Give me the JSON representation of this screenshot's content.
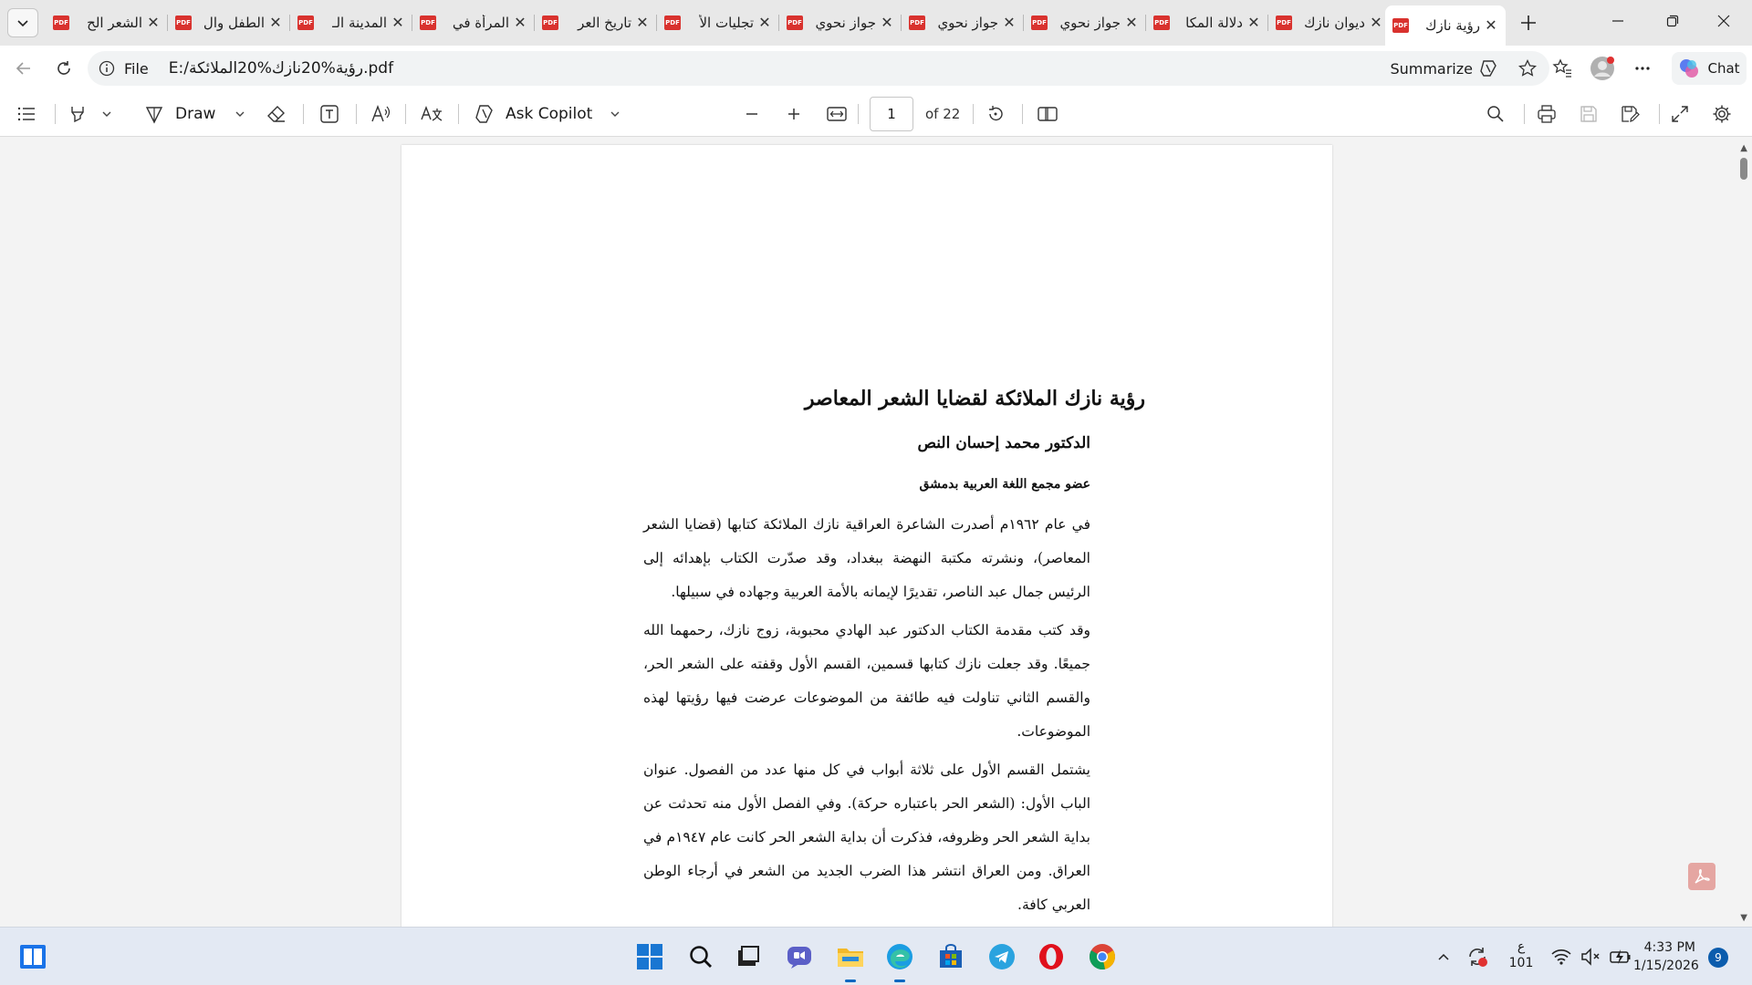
{
  "tabs": [
    {
      "title": "الشعر الح"
    },
    {
      "title": "الطفل وال"
    },
    {
      "title": "المدينة الـ"
    },
    {
      "title": "المرأة في"
    },
    {
      "title": "تاريخ العر"
    },
    {
      "title": "تجليات الأ"
    },
    {
      "title": "جواز نحوي"
    },
    {
      "title": "جواز نحوي"
    },
    {
      "title": "جواز نحوي"
    },
    {
      "title": "دلالة المكا"
    },
    {
      "title": "ديوان نازك"
    },
    {
      "title": "رؤية نازك"
    }
  ],
  "tab_icon_label": "PDF",
  "address": {
    "site_info_label": "File",
    "url": "E:/رؤية%20نازك%20الملائكة.pdf",
    "summarize_label": "Summarize",
    "chat_label": "Chat"
  },
  "pdf_toolbar": {
    "draw_label": "Draw",
    "ask_copilot_label": "Ask Copilot",
    "page_number": "1",
    "page_of": "of 22"
  },
  "document": {
    "title": "رؤية نازك الملائكة لقضايا الشعر المعاصر",
    "author": "الدكتور محمد إحسان النص",
    "role": "عضو مجمع اللغة العربية بدمشق",
    "paragraphs": [
      "في عام ١٩٦٢م أصدرت الشاعرة العراقية نازك الملائكة كتابها (قضايا الشعر المعاصر)، ونشرته مكتبة النهضة ببغداد، وقد صدّرت الكتاب بإهدائه إلى الرئيس جمال عبد الناصر، تقديرًا لإيمانه بالأمة العربية وجهاده في سبيلها.",
      "وقد كتب مقدمة الكتاب الدكتور عبد الهادي محبوبة، زوج نازك، رحمهما الله جميعًا. وقد جعلت نازك كتابها قسمين، القسم الأول وقفته على الشعر الحر، والقسم الثاني تناولت فيه طائفة من الموضوعات عرضت فيها رؤيتها لهذه الموضوعات.",
      "يشتمل القسم الأول على ثلاثة أبواب في كل منها عدد من الفصول. عنوان الباب الأول: (الشعر الحر باعتباره حركة). وفي الفصل الأول منه تحدثت عن بداية الشعر الحر وظروفه، فذكرت أن بداية الشعر الحر كانت عام ١٩٤٧م في العراق. ومن العراق انتشر هذا الضرب الجديد من الشعر في أرجاء الوطن العربي كافة."
    ]
  },
  "taskbar": {
    "tray_lang": "ع",
    "tray_sub": "101",
    "time": "4:33 PM",
    "date": "1/15/2026",
    "notification_count": "9"
  },
  "colors": {
    "pdf_red": "#d9322e",
    "accent_blue": "#0067c0",
    "opera_red": "#e0101c"
  }
}
